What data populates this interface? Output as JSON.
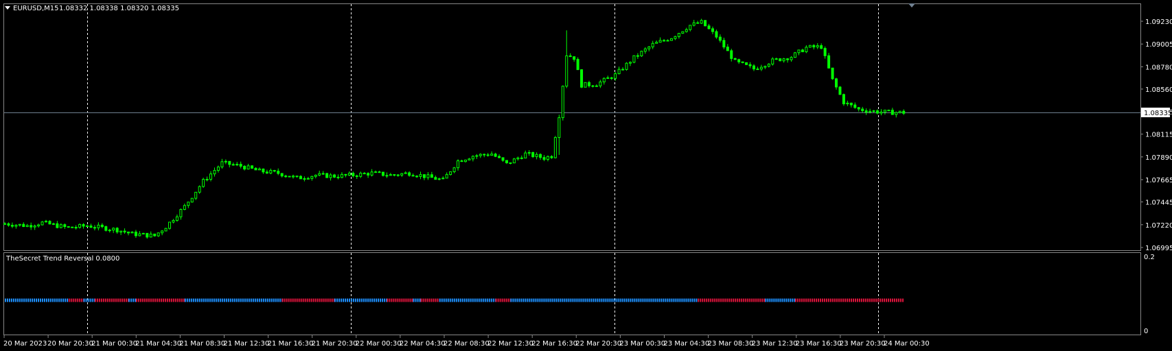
{
  "header": {
    "symbol": "EURUSD,M15",
    "ohlc": "1.08332 1.08338 1.08320 1.08335"
  },
  "indicator": {
    "title": "TheSecret Trend Reversal 0.0800",
    "scale_top": "0.2",
    "scale_bottom": "0"
  },
  "chart_data": {
    "type": "candlestick",
    "symbol": "EURUSD",
    "timeframe": "M15",
    "current_price": 1.08335,
    "price_ticks": [
      "1.09230",
      "1.09005",
      "1.08780",
      "1.08560",
      "1.08335",
      "1.08115",
      "1.07890",
      "1.07665",
      "1.07445",
      "1.07220",
      "1.06995"
    ],
    "time_ticks": [
      "20 Mar 2023",
      "20 Mar 20:30",
      "21 Mar 00:30",
      "21 Mar 04:30",
      "21 Mar 08:30",
      "21 Mar 12:30",
      "21 Mar 16:30",
      "21 Mar 20:30",
      "22 Mar 00:30",
      "22 Mar 04:30",
      "22 Mar 08:30",
      "22 Mar 12:30",
      "22 Mar 16:30",
      "22 Mar 20:30",
      "23 Mar 00:30",
      "23 Mar 04:30",
      "23 Mar 08:30",
      "23 Mar 12:30",
      "23 Mar 16:30",
      "23 Mar 20:30",
      "24 Mar 00:30"
    ],
    "ylim": [
      1.0697,
      1.0934
    ],
    "close_path": [
      [
        0,
        1.0723
      ],
      [
        6,
        1.0721
      ],
      [
        10,
        1.0724
      ],
      [
        14,
        1.0721
      ],
      [
        17,
        1.0719
      ],
      [
        22,
        1.0721
      ],
      [
        26,
        1.0719
      ],
      [
        30,
        1.0717
      ],
      [
        34,
        1.0713
      ],
      [
        40,
        1.0711
      ],
      [
        43,
        1.072
      ],
      [
        48,
        1.074
      ],
      [
        53,
        1.0765
      ],
      [
        58,
        1.0783
      ],
      [
        63,
        1.078
      ],
      [
        68,
        1.0775
      ],
      [
        73,
        1.0773
      ],
      [
        78,
        1.0768
      ],
      [
        83,
        1.0771
      ],
      [
        88,
        1.077
      ],
      [
        93,
        1.0771
      ],
      [
        98,
        1.0773
      ],
      [
        103,
        1.0771
      ],
      [
        108,
        1.0773
      ],
      [
        112,
        1.077
      ],
      [
        117,
        1.0766
      ],
      [
        121,
        1.0785
      ],
      [
        125,
        1.079
      ],
      [
        130,
        1.0792
      ],
      [
        134,
        1.0782
      ],
      [
        139,
        1.0792
      ],
      [
        144,
        1.0788
      ],
      [
        146,
        1.079
      ],
      [
        148,
        1.083
      ],
      [
        150,
        1.089
      ],
      [
        152,
        1.0887
      ],
      [
        154,
        1.086
      ],
      [
        158,
        1.0861
      ],
      [
        163,
        1.087
      ],
      [
        168,
        1.0887
      ],
      [
        173,
        1.09
      ],
      [
        178,
        1.0907
      ],
      [
        183,
        1.0919
      ],
      [
        186,
        1.0922
      ],
      [
        190,
        1.0908
      ],
      [
        195,
        1.0883
      ],
      [
        200,
        1.0876
      ],
      [
        205,
        1.0884
      ],
      [
        210,
        1.0888
      ],
      [
        214,
        1.0897
      ],
      [
        218,
        1.0898
      ],
      [
        221,
        1.0865
      ],
      [
        224,
        1.0843
      ],
      [
        228,
        1.0836
      ],
      [
        232,
        1.0834
      ],
      [
        236,
        1.0833
      ],
      [
        240,
        1.0833
      ]
    ],
    "indicator_segments": [
      {
        "color": "blue",
        "from": 0,
        "to": 17
      },
      {
        "color": "red",
        "from": 17,
        "to": 21
      },
      {
        "color": "blue",
        "from": 21,
        "to": 24
      },
      {
        "color": "red",
        "from": 24,
        "to": 33
      },
      {
        "color": "blue",
        "from": 33,
        "to": 35
      },
      {
        "color": "red",
        "from": 35,
        "to": 48
      },
      {
        "color": "blue",
        "from": 48,
        "to": 74
      },
      {
        "color": "red",
        "from": 74,
        "to": 88
      },
      {
        "color": "blue",
        "from": 88,
        "to": 102
      },
      {
        "color": "red",
        "from": 102,
        "to": 109
      },
      {
        "color": "blue",
        "from": 109,
        "to": 111
      },
      {
        "color": "red",
        "from": 111,
        "to": 116
      },
      {
        "color": "blue",
        "from": 116,
        "to": 131
      },
      {
        "color": "red",
        "from": 131,
        "to": 135
      },
      {
        "color": "blue",
        "from": 135,
        "to": 185
      },
      {
        "color": "red",
        "from": 185,
        "to": 203
      },
      {
        "color": "blue",
        "from": 203,
        "to": 211
      },
      {
        "color": "red",
        "from": 211,
        "to": 240
      }
    ]
  },
  "colors": {
    "background": "#000000",
    "candle": "#00ff00",
    "grid": "#ffffff",
    "price_line": "#708090",
    "indicator_blue": "#1e90ff",
    "indicator_red": "#dc143c",
    "axis_text": "#ffffff"
  }
}
